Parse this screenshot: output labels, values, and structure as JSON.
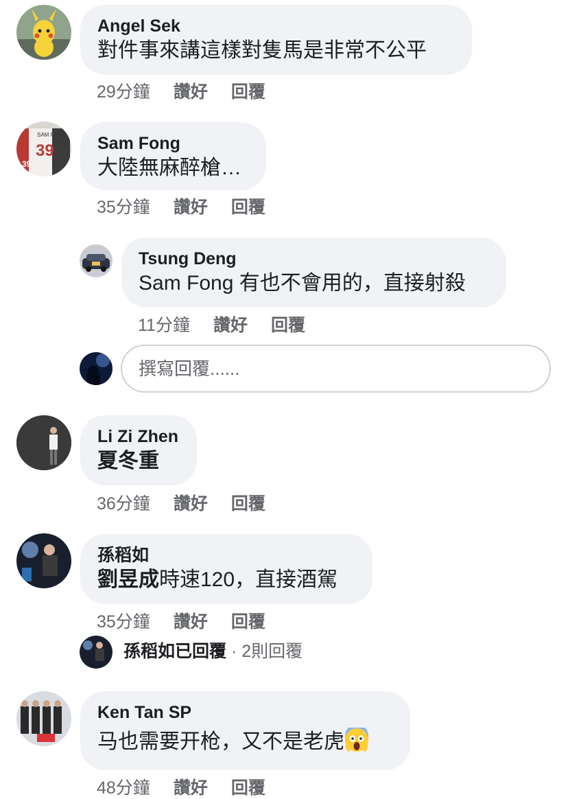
{
  "comments": [
    {
      "name": "Angel Sek",
      "text": "對件事來講這樣對隻馬是非常不公平",
      "time": "29分鐘",
      "like": "讚好",
      "reply": "回覆"
    },
    {
      "name": "Sam Fong",
      "text": "大陸無麻醉槍…",
      "time": "35分鐘",
      "like": "讚好",
      "reply": "回覆",
      "replies": [
        {
          "name": "Tsung Deng",
          "text": "Sam Fong 有也不會用的，直接射殺",
          "time": "11分鐘",
          "like": "讚好",
          "reply": "回覆"
        }
      ]
    },
    {
      "name": "Li Zi Zhen",
      "text": "夏冬重",
      "time": "36分鐘",
      "like": "讚好",
      "reply": "回覆"
    },
    {
      "name": "孫稻如",
      "text_bold": "劉昱成",
      "text": "時速120，直接酒駕",
      "time": "35分鐘",
      "like": "讚好",
      "reply": "回覆",
      "reply_summary": {
        "name": "孫稻如",
        "action": "已回覆",
        "separator": " · ",
        "count": "2則回覆"
      }
    },
    {
      "name": "Ken Tan SP",
      "text": "马也需要开枪，又不是老虎",
      "emoji": "scream-emoji",
      "time": "48分鐘",
      "like": "讚好",
      "reply": "回覆"
    }
  ],
  "reply_box": {
    "placeholder": "撰寫回覆......"
  }
}
